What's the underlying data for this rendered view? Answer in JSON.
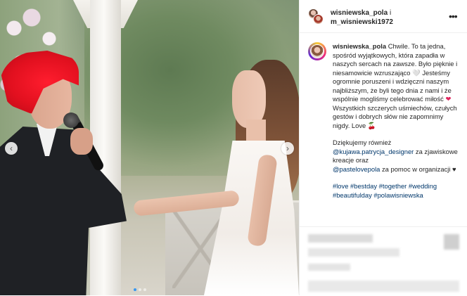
{
  "header": {
    "user1": "wisniewska_pola",
    "connector": "i",
    "user2": "m_wisniewski1972",
    "more_icon": "more-options-icon"
  },
  "caption": {
    "username": "wisniewska_pola",
    "line1": "Chwile. To ta jedna, spośród wyjątkowych, która zapadła w naszych sercach na zawsze. Było pięknie i niesamowicie wzruszająco 🤍 Jesteśmy ogromnie poruszeni i wdzięczni naszym najbliższym, że byli tego dnia z nami i że wspólnie mogliśmy celebrować miłość",
    "heart": "❤",
    "line2": " Wszystkich szczerych uśmiechów, czułych gestów i dobrych słów nie zapomnimy nigdy. Love",
    "cherry": "🍒",
    "thanks1": "Dziękujemy również",
    "mention1": "@kujawa.patrycja_designer",
    "thanks2": " za zjawiskowe kreacje oraz",
    "mention2": "@pastelovepola",
    "thanks3": " za pomoc w organizacji ♥",
    "hashtags": "#love #bestday #together #wedding #beautifulday #polawisniewska"
  },
  "photo": {
    "nav_left": "‹",
    "nav_right": "›"
  },
  "colors": {
    "link": "#00376b",
    "text": "#262626",
    "hair_red": "#e2101f"
  }
}
